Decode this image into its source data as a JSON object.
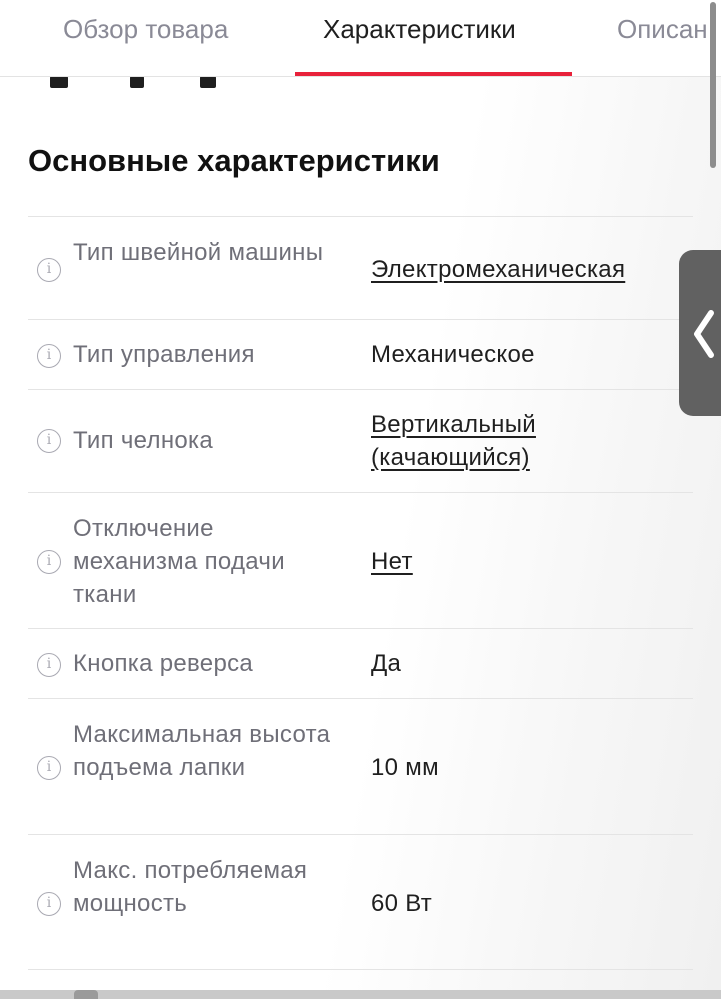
{
  "tabs": [
    {
      "label": "Обзор товара",
      "active": false
    },
    {
      "label": "Характеристики",
      "active": true
    },
    {
      "label": "Описан",
      "active": false
    }
  ],
  "accent_color": "#e8213a",
  "section": {
    "title": "Основные характеристики"
  },
  "specs": [
    {
      "name": "Тип швейной машины",
      "value": "Электромеханическая",
      "link": true
    },
    {
      "name": "Тип управления",
      "value": "Механическое",
      "link": false
    },
    {
      "name": "Тип челнока",
      "value": "Вертикальный (качающийся)",
      "link": true
    },
    {
      "name": "Отключение механизма подачи ткани",
      "value": "Нет",
      "link": true
    },
    {
      "name": "Кнопка реверса",
      "value": "Да",
      "link": false
    },
    {
      "name": "Максимальная высота подъема лапки",
      "value": "10 мм",
      "link": false
    },
    {
      "name": "Макс. потребляемая мощность",
      "value": "60 Вт",
      "link": false
    }
  ],
  "icons": {
    "info": "info-icon",
    "side_handle": "chevron-left-icon"
  }
}
